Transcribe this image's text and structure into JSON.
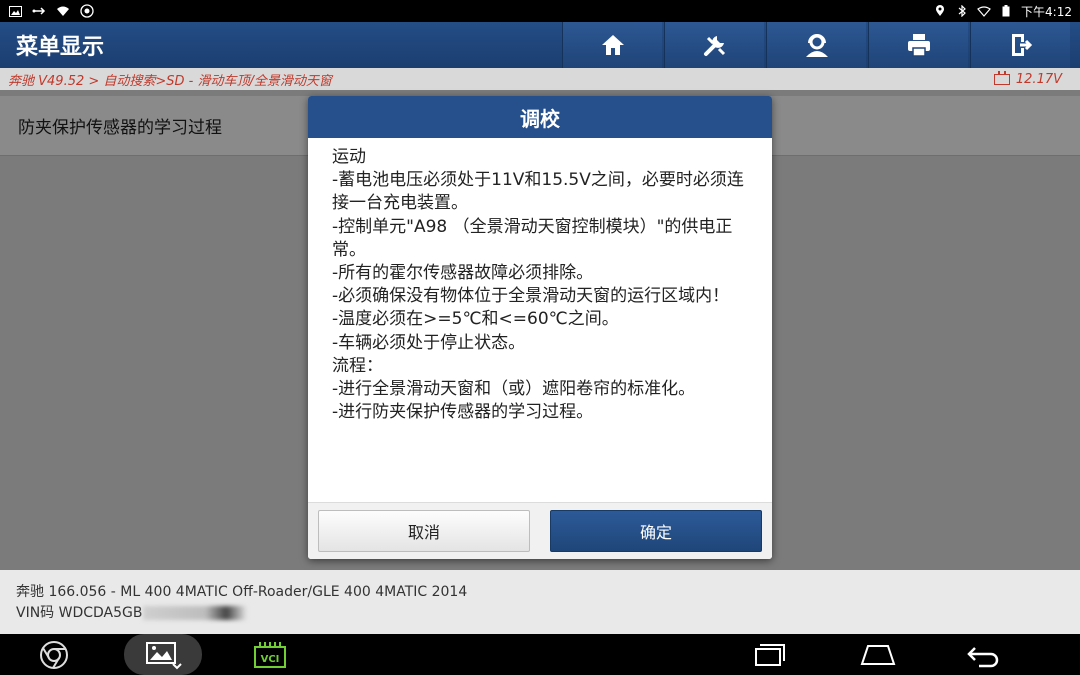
{
  "status_bar": {
    "time": "下午4:12",
    "icons_left": [
      "image-icon",
      "usb-debug-icon",
      "wifi-question-icon",
      "bug-icon"
    ],
    "icons_right": [
      "location-icon",
      "bluetooth-icon",
      "wifi-icon",
      "battery-icon"
    ]
  },
  "header": {
    "title": "菜单显示",
    "tools": [
      {
        "name": "home-button",
        "icon": "home-icon"
      },
      {
        "name": "diagnose-button",
        "icon": "wrench-icon"
      },
      {
        "name": "support-button",
        "icon": "headset-icon"
      },
      {
        "name": "print-button",
        "icon": "printer-icon"
      },
      {
        "name": "exit-button",
        "icon": "exit-icon"
      }
    ]
  },
  "breadcrumb": {
    "path": "奔驰 V49.52 > 自动搜索>SD - 滑动车顶/全景滑动天窗",
    "voltage": "12.17V"
  },
  "list": {
    "item": "防夹保护传感器的学习过程"
  },
  "dialog": {
    "title": "调校",
    "lines": [
      "运动",
      "-蓄电池电压必须处于11V和15.5V之间，必要时必须连接一台充电装置。",
      "-控制单元\"A98 （全景滑动天窗控制模块）\"的供电正常。",
      "-所有的霍尔传感器故障必须排除。",
      "-必须确保没有物体位于全景滑动天窗的运行区域内！",
      "-温度必须在>=5℃和<=60℃之间。",
      "-车辆必须处于停止状态。",
      "流程：",
      "-进行全景滑动天窗和（或）遮阳卷帘的标准化。",
      "-进行防夹保护传感器的学习过程。"
    ],
    "cancel_label": "取消",
    "ok_label": "确定"
  },
  "footer": {
    "vehicle": "奔驰 166.056 - ML 400 4MATIC Off-Roader/GLE 400 4MATIC 2014",
    "vin_prefix": "VIN码 WDCDA5GB"
  },
  "nav_bar": {
    "vci_label": "VCI",
    "buttons": [
      "chrome-icon",
      "gallery-icon",
      "vci-icon",
      "recents-icon",
      "home-nav-icon",
      "back-icon"
    ]
  },
  "colors": {
    "header_blue": "#244d86",
    "crumb_red": "#c0392b",
    "ok_blue": "#25508c"
  }
}
